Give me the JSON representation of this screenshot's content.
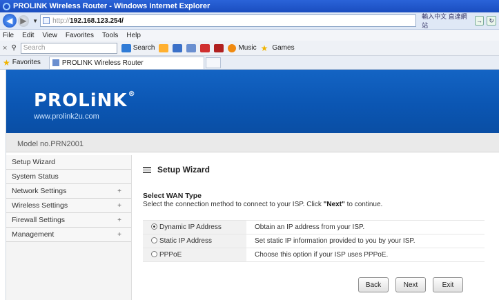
{
  "window": {
    "title": "PROLINK Wireless Router - Windows Internet Explorer"
  },
  "address": {
    "protocol": "http://",
    "host": "192.168.123.254/",
    "right_text": "輸入中文 直達網站"
  },
  "menu": [
    "File",
    "Edit",
    "View",
    "Favorites",
    "Tools",
    "Help"
  ],
  "toolbar": {
    "search_placeholder": "Search",
    "search_label": "Search",
    "music_label": "Music",
    "games_label": "Games"
  },
  "favbar": {
    "favorites_label": "Favorites",
    "tab_title": "PROLINK Wireless Router"
  },
  "banner": {
    "logo": "PROLiNK",
    "reg": "®",
    "url": "www.prolink2u.com"
  },
  "model": "Model no.PRN2001",
  "sidebar": {
    "items": [
      {
        "label": "Setup Wizard",
        "expand": ""
      },
      {
        "label": "System Status",
        "expand": ""
      },
      {
        "label": "Network Settings",
        "expand": "+"
      },
      {
        "label": "Wireless Settings",
        "expand": "+"
      },
      {
        "label": "Firewall Settings",
        "expand": "+"
      },
      {
        "label": "Management",
        "expand": "+"
      }
    ]
  },
  "wizard": {
    "title": "Setup Wizard",
    "section_title": "Select WAN Type",
    "description_prefix": "Select the connection method to connect to your ISP. Click ",
    "description_bold": "\"Next\"",
    "description_suffix": " to continue.",
    "options": [
      {
        "label": "Dynamic IP Address",
        "desc": "Obtain an IP address from your ISP.",
        "selected": true
      },
      {
        "label": "Static IP Address",
        "desc": "Set static IP information provided to you by your ISP.",
        "selected": false
      },
      {
        "label": "PPPoE",
        "desc": "Choose this option if your ISP uses PPPoE.",
        "selected": false
      }
    ],
    "buttons": {
      "back": "Back",
      "next": "Next",
      "exit": "Exit"
    }
  }
}
